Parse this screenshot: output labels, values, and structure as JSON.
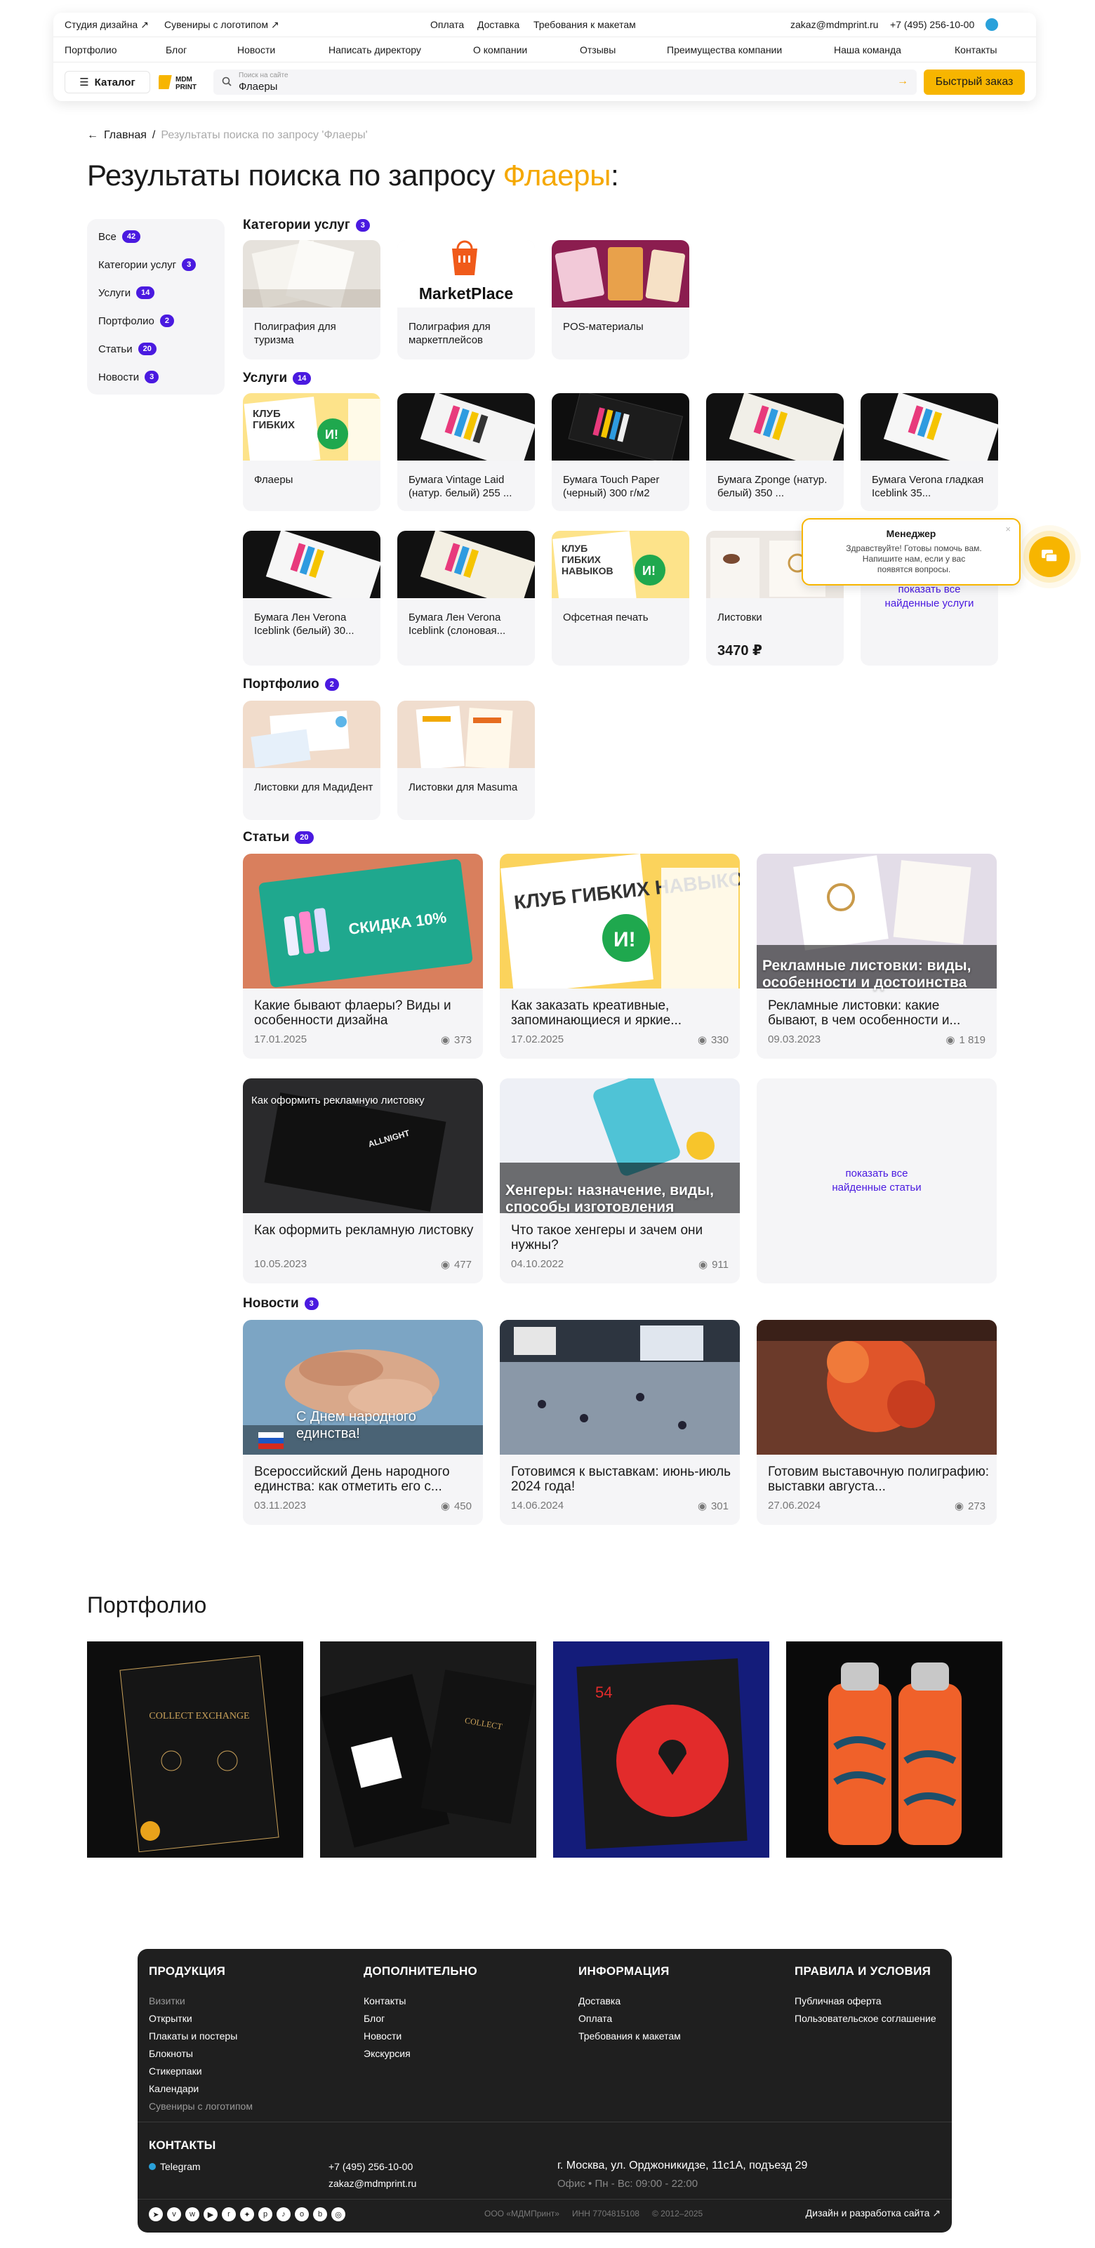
{
  "header": {
    "top_left": [
      "Студия дизайна ↗",
      "Сувениры с логотипом ↗"
    ],
    "top_center": [
      "Оплата",
      "Доставка",
      "Требования к макетам"
    ],
    "email": "zakaz@mdmprint.ru",
    "phone": "+7 (495) 256-10-00",
    "nav": [
      "Портфолио",
      "Блог",
      "Новости",
      "Написать директору",
      "О компании",
      "Отзывы",
      "Преимущества компании",
      "Наша команда",
      "Контакты"
    ],
    "catalog_label": "Каталог",
    "logo_text": "MDM PRINT",
    "search_placeholder": "Поиск на сайте",
    "search_value": "Флаеры",
    "quick_order": "Быстрый заказ"
  },
  "breadcrumbs": {
    "home": "Главная",
    "current": "Результаты поиска по запросу 'Флаеры'"
  },
  "title": {
    "prefix": "Результаты поиска по запросу ",
    "query": "Флаеры",
    "suffix": ":"
  },
  "sidebar": [
    {
      "label": "Все",
      "count": "42"
    },
    {
      "label": "Категории услуг",
      "count": "3"
    },
    {
      "label": "Услуги",
      "count": "14"
    },
    {
      "label": "Портфолио",
      "count": "2"
    },
    {
      "label": "Статьи",
      "count": "20"
    },
    {
      "label": "Новости",
      "count": "3"
    }
  ],
  "categories": {
    "title": "Категории услуг",
    "count": "3",
    "items": [
      {
        "label": "Полиграфия для туризма"
      },
      {
        "label": "Полиграфия для маркетплейсов",
        "img_text": "MarketPlace"
      },
      {
        "label": "POS-материалы"
      }
    ]
  },
  "services": {
    "title": "Услуги",
    "count": "14",
    "items": [
      {
        "label": "Флаеры"
      },
      {
        "label": "Бумага Vintage Laid (натур. белый) 255 ..."
      },
      {
        "label": "Бумага Touch Paper (черный) 300 г/м2"
      },
      {
        "label": "Бумага Zponge (натур. белый) 350 ..."
      },
      {
        "label": "Бумага Verona гладкая Iceblink 35..."
      },
      {
        "label": "Бумага Лен Verona Iceblink (белый) 30..."
      },
      {
        "label": "Бумага Лен Verona Iceblink (слоновая..."
      },
      {
        "label": "Офсетная печать"
      },
      {
        "label": "Листовки",
        "price": "3470 ₽"
      }
    ],
    "show_all": "показать все найденные услуги"
  },
  "portfolio_results": {
    "title": "Портфолио",
    "count": "2",
    "items": [
      {
        "label": "Листовки для МадиДент"
      },
      {
        "label": "Листовки для Masuma"
      }
    ]
  },
  "articles": {
    "title": "Статьи",
    "count": "20",
    "items": [
      {
        "title": "Какие бывают флаеры? Виды и особенности дизайна",
        "date": "17.01.2025",
        "views": "373",
        "img_title": "СКИДКА 10%"
      },
      {
        "title": "Как заказать креативные, запоминающиеся и яркие...",
        "date": "17.02.2025",
        "views": "330",
        "img_title": "КЛУБ ГИБКИХ НАВЫКОВ"
      },
      {
        "title": "Рекламные листовки: какие бывают, в чем особенности и...",
        "date": "09.03.2023",
        "views": "1 819",
        "img_title": "Рекламные листовки: виды, особенности и достоинства"
      },
      {
        "title": "Как оформить рекламную листовку",
        "date": "10.05.2023",
        "views": "477",
        "img_title": "Как оформить рекламную листовку"
      },
      {
        "title": "Что такое хенгеры и зачем они нужны?",
        "date": "04.10.2022",
        "views": "911",
        "img_title": "Хенгеры: назначение, виды, способы изготовления"
      }
    ],
    "show_all": "показать все найденные статьи"
  },
  "news": {
    "title": "Новости",
    "count": "3",
    "items": [
      {
        "title": "Всероссийский День народного единства: как отметить его с...",
        "date": "03.11.2023",
        "views": "450",
        "img_title": "С Днем народного единства!"
      },
      {
        "title": "Готовимся к выставкам: июнь-июль 2024 года!",
        "date": "14.06.2024",
        "views": "301"
      },
      {
        "title": "Готовим выставочную полиграфию: выставки августа...",
        "date": "27.06.2024",
        "views": "273"
      }
    ]
  },
  "portfolio_title": "Портфолио",
  "footer": {
    "cols": [
      {
        "title": "ПРОДУКЦИЯ",
        "links": [
          "Визитки",
          "Открытки",
          "Плакаты и постеры",
          "Блокноты",
          "Стикерпаки",
          "Календари",
          "Сувениры с логотипом"
        ]
      },
      {
        "title": "ДОПОЛНИТЕЛЬНО",
        "links": [
          "Контакты",
          "Блог",
          "Новости",
          "Экскурсия"
        ]
      },
      {
        "title": "ИНФОРМАЦИЯ",
        "links": [
          "Доставка",
          "Оплата",
          "Требования к макетам"
        ]
      },
      {
        "title": "ПРАВИЛА И УСЛОВИЯ",
        "links": [
          "Публичная оферта",
          "Пользовательское соглашение"
        ]
      }
    ],
    "contacts_title": "КОНТАКТЫ",
    "telegram": "Telegram",
    "phone": "+7 (495) 256-10-00",
    "email": "zakaz@mdmprint.ru",
    "address": "г. Москва, ул. Орджоникидзе, 11с1А, подъезд 29",
    "hours": "Офис • Пн - Вс: 09:00 - 22:00",
    "company": "ООО «МДМПринт»",
    "inn": "ИНН 7704815108",
    "years": "© 2012–2025",
    "design": "Дизайн и разработка сайта ↗"
  },
  "manager": {
    "title": "Менеджер",
    "text": "Здравствуйте! Готовы помочь вам. Напишите нам, если у вас появятся вопросы."
  },
  "colors": {
    "accent": "#f7b500",
    "badge": "#4a1ae0",
    "card_bg": "#f5f5f7",
    "footer_bg": "#1f1f1f"
  }
}
